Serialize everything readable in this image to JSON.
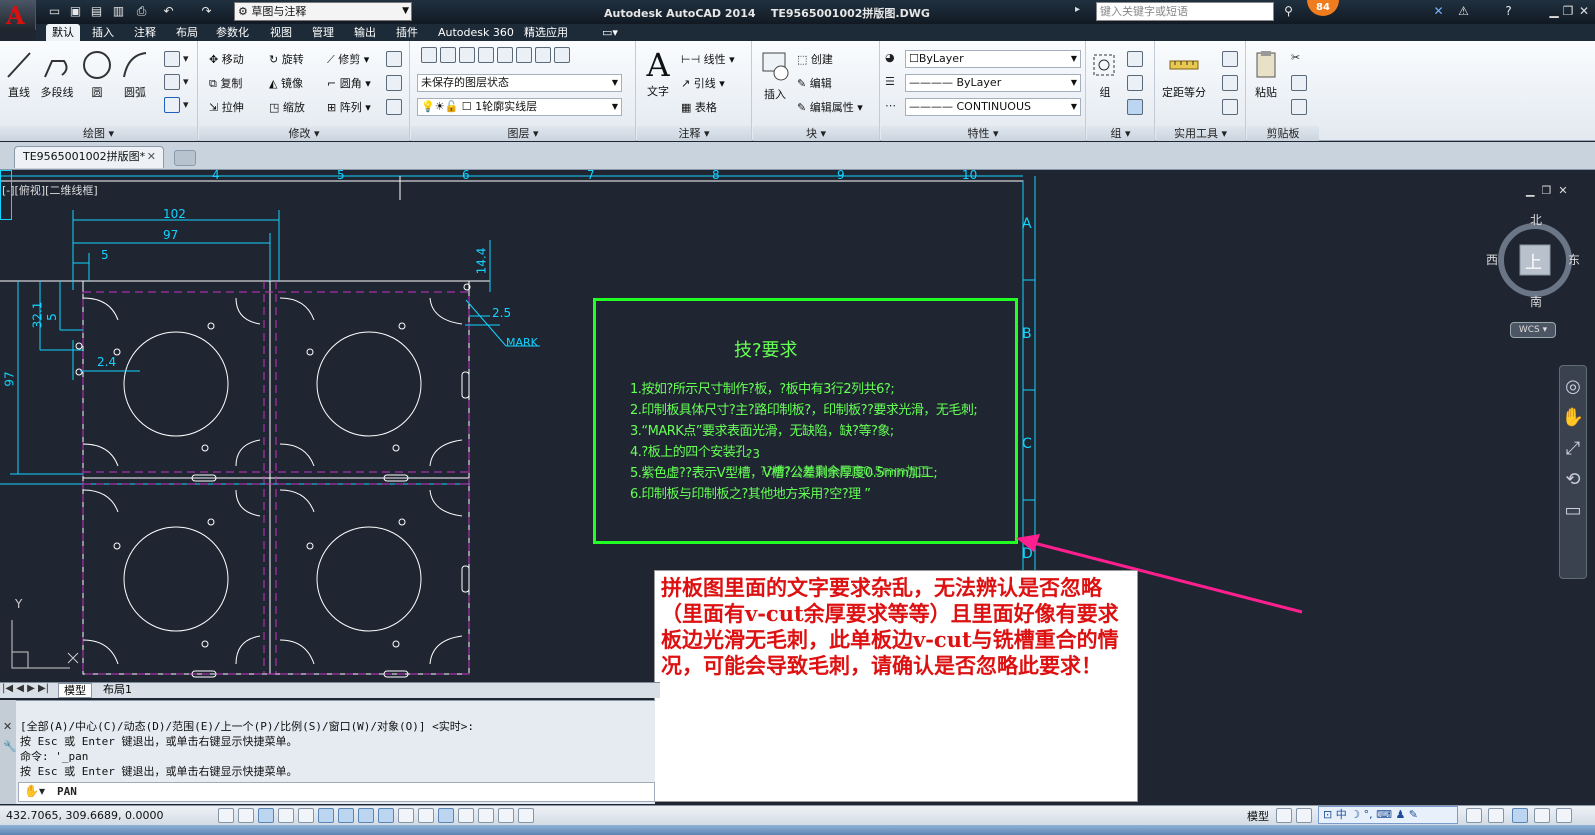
{
  "title_bar": {
    "app_title": "Autodesk AutoCAD 2014",
    "file_title": "TE9565001002拼版图.DWG",
    "workspace": "草图与注释",
    "search_placeholder": "键入关键字或短语",
    "notification_count": "84"
  },
  "ribbon_tabs": [
    "默认",
    "插入",
    "注释",
    "布局",
    "参数化",
    "视图",
    "管理",
    "输出",
    "插件",
    "Autodesk 360",
    "精选应用"
  ],
  "ribbon": {
    "draw": {
      "title": "绘图",
      "line": "直线",
      "polyline": "多段线",
      "circle": "圆",
      "arc": "圆弧"
    },
    "modify": {
      "title": "修改",
      "move": "移动",
      "rotate": "旋转",
      "trim": "修剪",
      "copy": "复制",
      "mirror": "镜像",
      "fillet": "圆角",
      "stretch": "拉伸",
      "scale": "缩放",
      "array": "阵列"
    },
    "layers": {
      "title": "图层",
      "state": "未保存的图层状态",
      "current": "1轮廓实线层"
    },
    "annotation": {
      "title": "注释",
      "text": "文字",
      "linear": "线性",
      "leader": "引线",
      "table": "表格"
    },
    "block": {
      "title": "块",
      "insert": "插入",
      "create": "创建",
      "edit": "编辑",
      "edit_attr": "编辑属性"
    },
    "properties": {
      "title": "特性",
      "color": "ByLayer",
      "lineweight": "ByLayer",
      "linetype": "CONTINUOUS"
    },
    "groups": {
      "title": "组",
      "group": "组"
    },
    "utilities": {
      "title": "实用工具",
      "measure": "定距等分"
    },
    "clipboard": {
      "title": "剪贴板",
      "paste": "粘贴"
    }
  },
  "doc_tab": "TE9565001002拼版图*",
  "viewport_label": "[-][俯视][二维线框]",
  "viewcube": {
    "north": "北",
    "south": "南",
    "east": "东",
    "west": "西",
    "top": "上",
    "wcs": "WCS"
  },
  "drawing": {
    "dims": {
      "d102": "102",
      "d97": "97",
      "d5": "5",
      "d14_4": "14.4",
      "d2_5": "2.5",
      "d32_1": "32.1",
      "d5v": "5",
      "d97v": "97",
      "d2_4": "2.4"
    },
    "mark_label": "MARK",
    "border_letters": [
      "A",
      "B",
      "C",
      "D"
    ],
    "border_numbers": [
      "4",
      "5",
      "6",
      "7",
      "8",
      "9",
      "10"
    ],
    "tech_title": "技?要求",
    "tech_lines": [
      "1.按如?所示尺寸制作?板，?板中有3行2列共6?;",
      "2.印制板具体尺寸?主?路印制板?，印制板??要求光滑，无毛刺;",
      "3.“MARK点”要求表面光滑，无缺陷，缺?等?象;",
      "4.?板上的四个安装孔",
      "5.紫色虚??表示V型槽，V槽?公差剩余厚度0.5mm加工;",
      "6.印制板与印制板之?其他地方采用?空?理 ”"
    ],
    "overlap_text": "?3",
    "overlap_text2": "??槽?公差剩余厚度0.5mm加工"
  },
  "note": "拼板图里面的文字要求杂乱，无法辨认是否忽略（里面有v-cut余厚要求等等）且里面好像有要求板边光滑无毛刺，此单板边v-cut与铣槽重合的情况，可能会导致毛刺，请确认是否忽略此要求！",
  "layout_tabs": [
    "模型",
    "布局1"
  ],
  "command_history": [
    "[全部(A)/中心(C)/动态(D)/范围(E)/上一个(P)/比例(S)/窗口(W)/对象(O)] <实时>:",
    "按 Esc 或 Enter 键退出，或单击右键显示快捷菜单。",
    "命令: '_pan",
    "按 Esc 或 Enter 键退出，或单击右键显示快捷菜单。"
  ],
  "command_input": "PAN",
  "status": {
    "coords": "432.7065, 309.6689, 0.0000",
    "model": "模型",
    "ime": "中"
  },
  "colors": {
    "green": "#22ff22",
    "cyan": "#13d3ff",
    "magenta": "#c431c4",
    "red_note": "#dd1111",
    "arrow": "#ff1f8e"
  }
}
